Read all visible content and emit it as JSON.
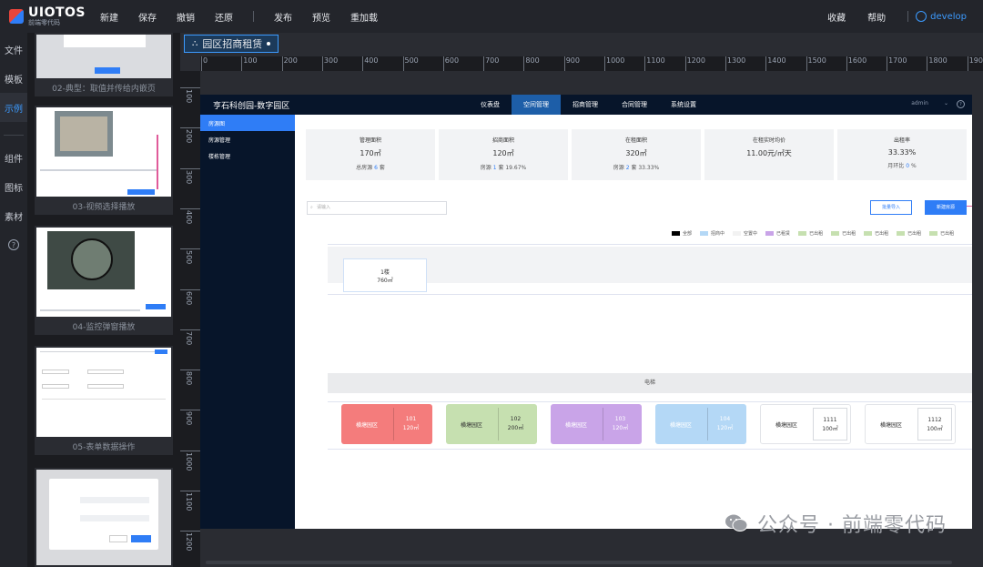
{
  "brand": {
    "title": "UIOTOS",
    "subtitle": "前端零代码"
  },
  "menu": {
    "items": [
      "新建",
      "保存",
      "撤销",
      "还原",
      "发布",
      "预览",
      "重加载"
    ]
  },
  "right_menu": {
    "favorites": "收藏",
    "help": "帮助",
    "user": "develop"
  },
  "leftnav": {
    "items": [
      "文件",
      "模板",
      "示例",
      "组件",
      "图标",
      "素材"
    ],
    "active": "示例"
  },
  "thumbnails": [
    {
      "label": "02-典型：取值并传给内嵌页"
    },
    {
      "label": "03-视频选择播放"
    },
    {
      "label": "04-监控弹窗播放"
    },
    {
      "label": "05-表单数据操作"
    },
    {
      "label": ""
    }
  ],
  "tab": {
    "title": "园区招商租赁"
  },
  "ruler_h": [
    "0",
    "100",
    "200",
    "300",
    "400",
    "500",
    "600",
    "700",
    "800",
    "900",
    "1000",
    "1100",
    "1200",
    "1300",
    "1400",
    "1500",
    "1600",
    "1700",
    "1800",
    "1900"
  ],
  "ruler_v": [
    "100",
    "200",
    "300",
    "400",
    "500",
    "600",
    "700",
    "800",
    "900",
    "1000",
    "1100",
    "1200"
  ],
  "app": {
    "title": "亨石科创园-数字园区",
    "tabs": [
      "仪表盘",
      "空间管理",
      "招商管理",
      "合同管理",
      "系统设置"
    ],
    "active_tab": "空间管理",
    "user": "admin",
    "side": [
      "房源图",
      "房源管理",
      "楼栋管理"
    ],
    "side_active": "房源图",
    "stats": [
      {
        "label": "管理面积",
        "value": "170㎡",
        "sub_pre": "总房源",
        "sub_num": "6",
        "sub_post": "套"
      },
      {
        "label": "招商面积",
        "value": "120㎡",
        "sub_pre": "房源",
        "sub_num": "1",
        "sub_post": "套 19.67%"
      },
      {
        "label": "在租面积",
        "value": "320㎡",
        "sub_pre": "房源",
        "sub_num": "2",
        "sub_post": "套 33.33%"
      },
      {
        "label": "在租实时均价",
        "value": "11.00元/㎡天",
        "sub_pre": "",
        "sub_num": "",
        "sub_post": ""
      },
      {
        "label": "出租率",
        "value": "33.33%",
        "sub_pre": "月环比",
        "sub_num": "0",
        "sub_post": "%"
      }
    ],
    "search_placeholder": "请输入",
    "import_label": "批量导入",
    "add_label": "新建房源",
    "legend": [
      {
        "label": "全部",
        "color": "#000000"
      },
      {
        "label": "招商中",
        "color": "#b4d8f6"
      },
      {
        "label": "空置中",
        "color": "#f2f2f2"
      },
      {
        "label": "已租赁",
        "color": "#c9a4e8"
      },
      {
        "label": "已出租",
        "color": "#c6e0b0"
      },
      {
        "label": "已出租",
        "color": "#c6e0b0"
      },
      {
        "label": "已出租",
        "color": "#c6e0b0"
      },
      {
        "label": "已出租",
        "color": "#c6e0b0"
      },
      {
        "label": "已出租",
        "color": "#c6e0b0"
      }
    ],
    "building": {
      "name": "1楼",
      "area": "760㎡"
    },
    "elevator": "电梯",
    "rooms": [
      {
        "park": "横塘园区",
        "no": "101",
        "area": "120㎡",
        "color": "#f47c7c"
      },
      {
        "park": "横塘园区",
        "no": "102",
        "area": "200㎡",
        "color": "#c6e0b0"
      },
      {
        "park": "横塘园区",
        "no": "103",
        "area": "120㎡",
        "color": "#c9a4e8"
      },
      {
        "park": "横塘园区",
        "no": "104",
        "area": "120㎡",
        "color": "#b4d8f6"
      },
      {
        "park": "横塘园区",
        "no": "1111",
        "area": "100㎡",
        "color": "#ffffff"
      },
      {
        "park": "横塘园区",
        "no": "1112",
        "area": "100㎡",
        "color": "#ffffff"
      }
    ]
  },
  "watermark": "公众号 · 前端零代码"
}
